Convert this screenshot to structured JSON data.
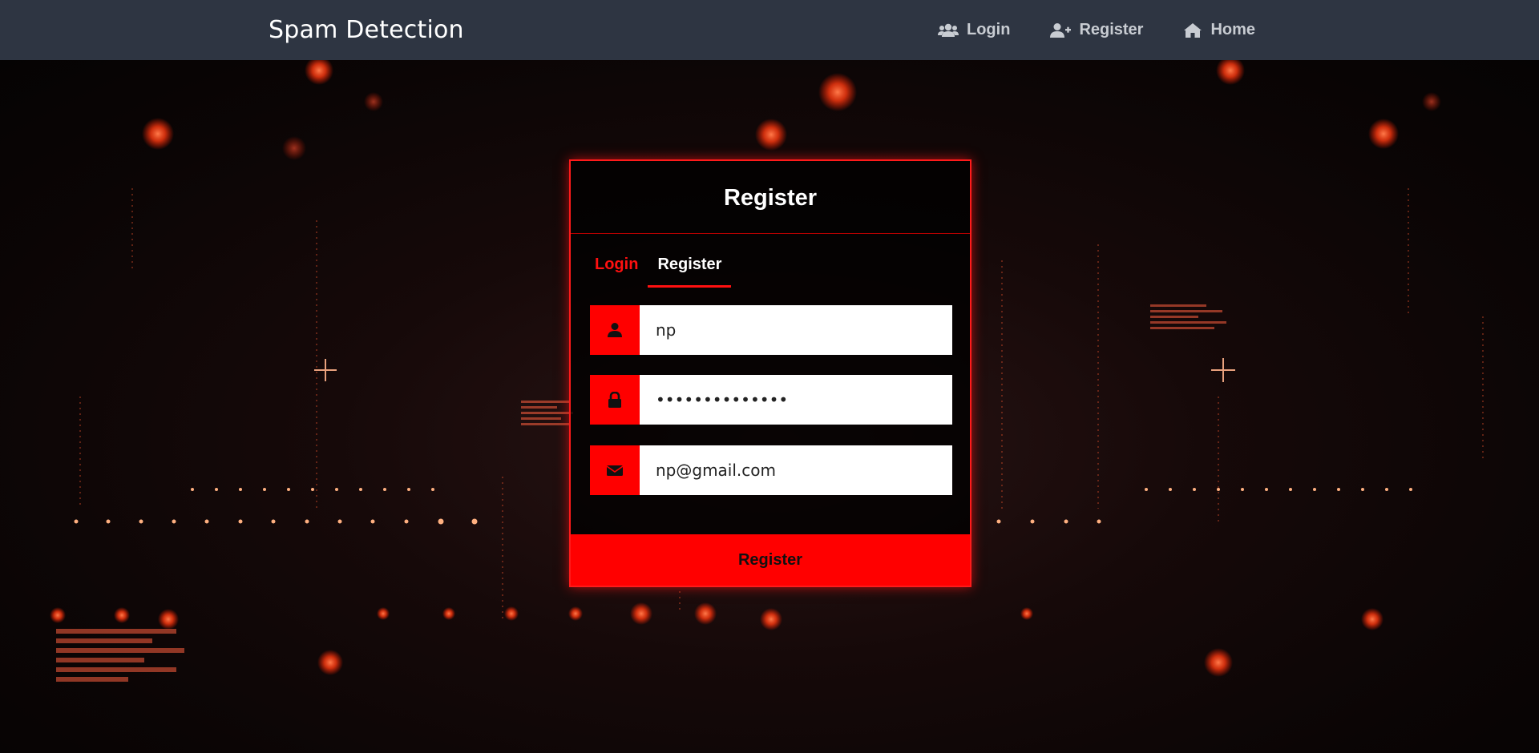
{
  "navbar": {
    "brand": "Spam Detection",
    "links": [
      {
        "label": "Login",
        "icon": "users-icon"
      },
      {
        "label": "Register",
        "icon": "user-plus-icon"
      },
      {
        "label": "Home",
        "icon": "home-icon"
      }
    ]
  },
  "card": {
    "title": "Register",
    "tabs": [
      {
        "label": "Login",
        "active": false
      },
      {
        "label": "Register",
        "active": true
      }
    ],
    "fields": [
      {
        "icon": "user-icon",
        "value": "np",
        "type": "text"
      },
      {
        "icon": "lock-icon",
        "value": "np1234567890ab",
        "type": "password"
      },
      {
        "icon": "envelope-icon",
        "value": "np@gmail.com",
        "type": "email"
      }
    ],
    "submit_label": "Register"
  },
  "colors": {
    "navbar_bg": "#2e3542",
    "accent": "#ff0000",
    "nav_text": "#c8ccd2"
  }
}
